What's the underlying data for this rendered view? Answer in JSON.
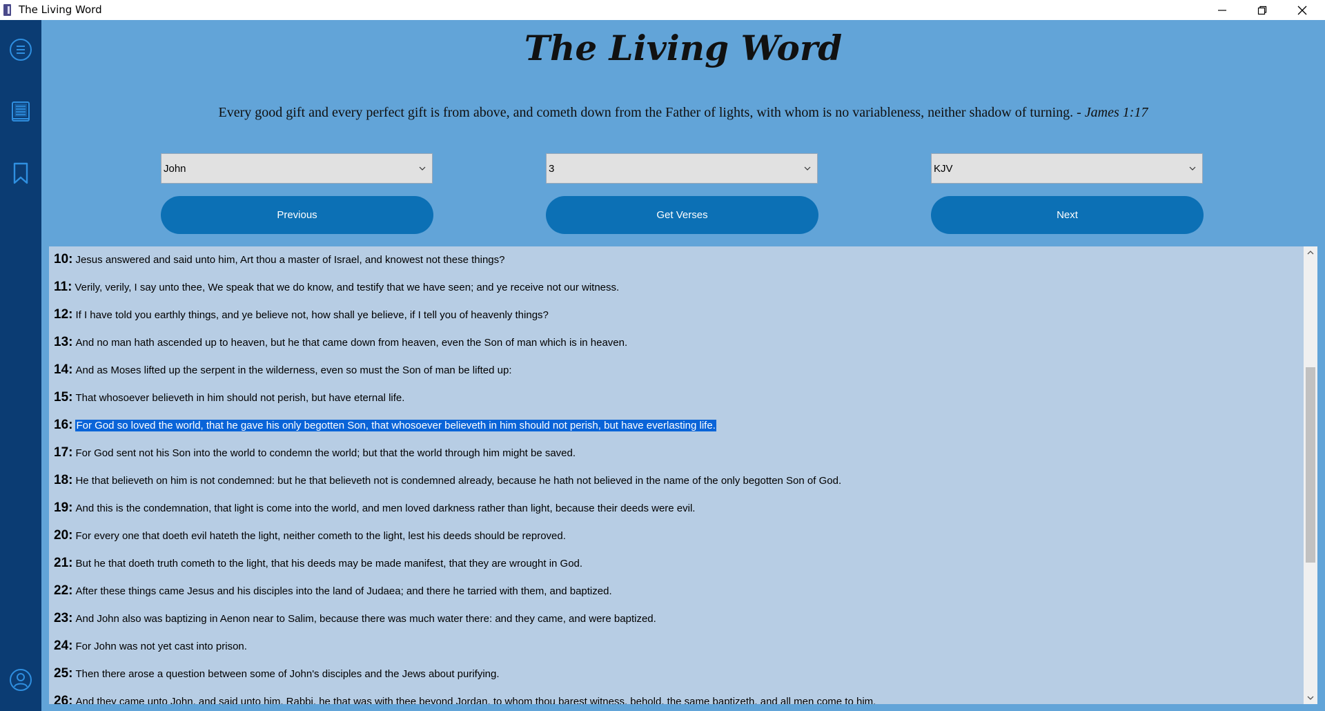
{
  "window": {
    "title": "The Living Word"
  },
  "sidebar": {
    "items": [
      {
        "name": "menu-icon"
      },
      {
        "name": "book-icon"
      },
      {
        "name": "bookmark-icon"
      },
      {
        "name": "user-icon"
      }
    ]
  },
  "header": {
    "title": "The Living Word",
    "quote": "Every good gift and every perfect gift is from above, and cometh down from the Father of lights, with whom is no variableness, neither shadow of turning.",
    "quote_ref": "- James 1:17"
  },
  "controls": {
    "book": "John",
    "chapter": "3",
    "version": "KJV",
    "previous_label": "Previous",
    "get_verses_label": "Get Verses",
    "next_label": "Next"
  },
  "verses": [
    {
      "num": "10:",
      "text": "Jesus answered and said unto him, Art thou a master of Israel, and knowest not these things?"
    },
    {
      "num": "11:",
      "text": "Verily, verily, I say unto thee, We speak that we do know, and testify that we have seen; and ye receive not our witness."
    },
    {
      "num": "12:",
      "text": "If I have told you earthly things, and ye believe not, how shall ye believe, if I tell you of heavenly things?"
    },
    {
      "num": "13:",
      "text": "And no man hath ascended up to heaven, but he that came down from heaven, even the Son of man which is in heaven."
    },
    {
      "num": "14:",
      "text": "And as Moses lifted up the serpent in the wilderness, even so must the Son of man be lifted up:"
    },
    {
      "num": "15:",
      "text": "That whosoever believeth in him should not perish, but have eternal life."
    },
    {
      "num": "16:",
      "text": "For God so loved the world, that he gave his only begotten Son, that whosoever believeth in him should not perish, but have everlasting life."
    },
    {
      "num": "17:",
      "text": "For God sent not his Son into the world to condemn the world; but that the world through him might be saved."
    },
    {
      "num": "18:",
      "text": "He that believeth on him is not condemned: but he that believeth not is condemned already, because he hath not believed in the name of the only begotten Son of God."
    },
    {
      "num": "19:",
      "text": "And this is the condemnation, that light is come into the world, and men loved darkness rather than light, because their deeds were evil."
    },
    {
      "num": "20:",
      "text": "For every one that doeth evil hateth the light, neither cometh to the light, lest his deeds should be reproved."
    },
    {
      "num": "21:",
      "text": "But he that doeth truth cometh to the light, that his deeds may be made manifest, that they are wrought in God."
    },
    {
      "num": "22:",
      "text": "After these things came Jesus and his disciples into the land of Judaea; and there he tarried with them, and baptized."
    },
    {
      "num": "23:",
      "text": "And John also was baptizing in Aenon near to Salim, because there was much water there: and they came, and were baptized."
    },
    {
      "num": "24:",
      "text": "For John was not yet cast into prison."
    },
    {
      "num": "25:",
      "text": "Then there arose a question between some of John's disciples and the Jews about purifying."
    },
    {
      "num": "26:",
      "text": "And they came unto John, and said unto him, Rabbi, he that was with thee beyond Jordan, to whom thou barest witness, behold, the same baptizeth, and all men come to him."
    }
  ],
  "selected_verse": "16:"
}
